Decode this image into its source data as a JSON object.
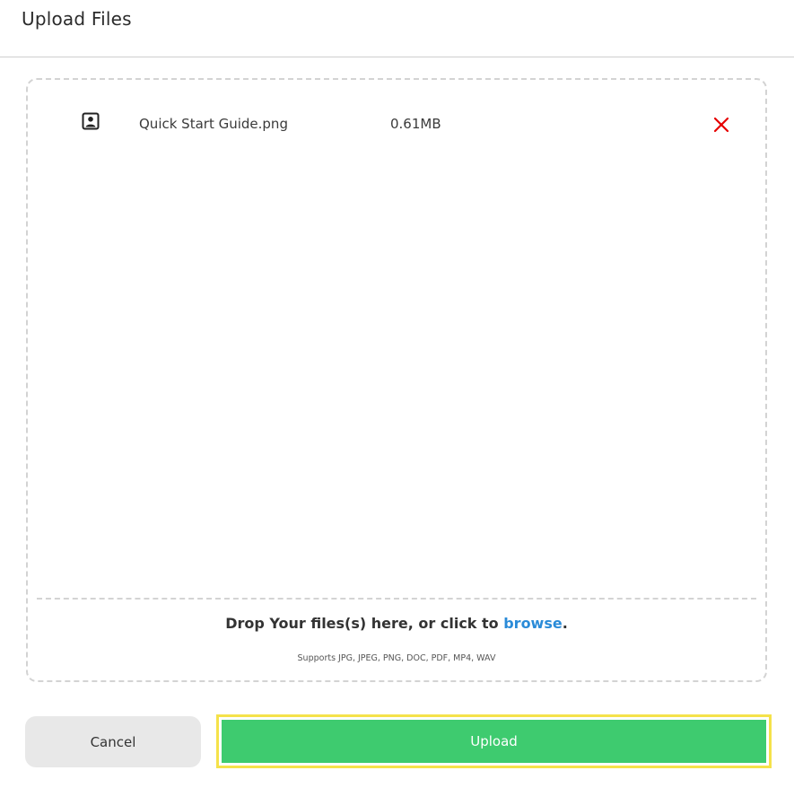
{
  "dialog": {
    "title": "Upload Files"
  },
  "files": [
    {
      "name": "Quick Start Guide.png",
      "size": "0.61MB",
      "icon": "portrait-image-icon",
      "remove_icon": "close-icon"
    }
  ],
  "dropzone": {
    "prompt": "Drop Your files(s) here, or click to ",
    "browse_label": "browse",
    "period": ".",
    "supports": "Supports JPG, JPEG, PNG, DOC, PDF, MP4, WAV"
  },
  "actions": {
    "cancel_label": "Cancel",
    "upload_label": "Upload"
  },
  "colors": {
    "upload_button": "#3ecb6f",
    "focus_outline": "#f5e24a",
    "remove_icon": "#e60000",
    "browse_link": "#2a8bd8"
  }
}
